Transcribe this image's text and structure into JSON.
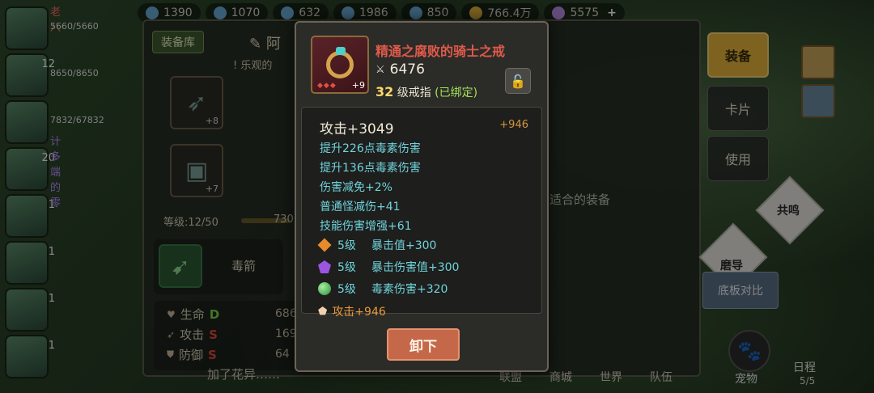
{
  "resources": [
    {
      "icon": "crystal-icon",
      "value": "1390"
    },
    {
      "icon": "ore-icon",
      "value": "1070"
    },
    {
      "icon": "stone-icon",
      "value": "632"
    },
    {
      "icon": "material-icon",
      "value": "1986"
    },
    {
      "icon": "leaf-icon",
      "value": "850"
    },
    {
      "icon": "gold-coin-icon",
      "value": "766.4万"
    },
    {
      "icon": "gem-icon",
      "value": "5575"
    }
  ],
  "resource_plus": "+",
  "team": {
    "heroes": [
      {
        "level": "",
        "name": "老八",
        "hp": "5660/5660"
      },
      {
        "level": "12",
        "name": "",
        "hp": "8650/8650"
      },
      {
        "level": "",
        "name": "",
        "hp": "7832/67832"
      },
      {
        "level": "20",
        "name": "",
        "hp": ""
      },
      {
        "level": "1",
        "name": "",
        "hp": ""
      },
      {
        "level": "1",
        "name": "",
        "hp": ""
      },
      {
        "level": "1",
        "name": "",
        "hp": ""
      },
      {
        "level": "1",
        "name": "",
        "hp": ""
      }
    ],
    "hint": "计多端的零"
  },
  "equip_window": {
    "tab": "装备库",
    "hero_name": "阿",
    "hero_subtitle": "乐观的",
    "slots": [
      {
        "plus": "+8"
      },
      {
        "plus": "+7"
      }
    ],
    "level_label": "等级:12/50",
    "exp_value": "730",
    "skill_name": "毒箭",
    "stats": [
      {
        "label": "生命",
        "grade": "D",
        "grade_color": "#7ad14a",
        "value": "686"
      },
      {
        "label": "攻击",
        "grade": "S",
        "grade_color": "#e04a3a",
        "value": "169"
      },
      {
        "label": "防御",
        "grade": "S",
        "grade_color": "#e04a3a",
        "value": "64"
      }
    ],
    "suit_hint": "适合的装备",
    "chat": "加了花异……"
  },
  "right_menu": {
    "equip": "装备",
    "card": "卡片",
    "use": "使用",
    "resonance": "共鸣",
    "grind": "磨导",
    "compare": "底板对比"
  },
  "bottom_nav": {
    "items": [
      "联盟",
      "商城",
      "世界",
      "队伍"
    ],
    "pet": "宠物",
    "schedule": "日程",
    "schedule_count": "5/5"
  },
  "item": {
    "title": "精通之腐败的骑士之戒",
    "enhance": "+9",
    "power": "6476",
    "level": "32",
    "level_text": "级戒指",
    "bind": "(已绑定)",
    "attack": "攻击+3049",
    "attack_bonus": "+946",
    "lines": [
      "提升226点毒素伤害",
      "提升136点毒素伤害",
      "伤害减免+2%",
      "普通怪减伤+41",
      "技能伤害增强+61"
    ],
    "gems": [
      {
        "color": "orange",
        "level": "5级",
        "text": "暴击值+300"
      },
      {
        "color": "purple",
        "level": "5级",
        "text": "暴击伤害值+300"
      },
      {
        "color": "green",
        "level": "5级",
        "text": "毒素伤害+320"
      }
    ],
    "set_text": "攻击+946",
    "unequip": "卸下"
  }
}
